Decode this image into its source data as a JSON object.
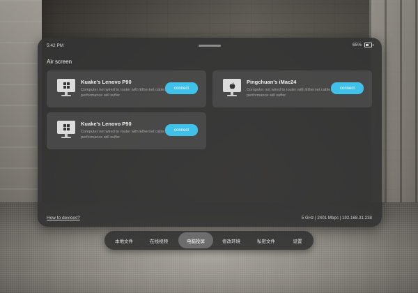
{
  "status_bar": {
    "time": "5:42 PM",
    "battery": "65%"
  },
  "section_title": "Air screen",
  "devices": [
    {
      "name": "Kuake's Lenovo P90",
      "description": "Computer not wired to router with Ethernet cable, performance will suffer",
      "button": "connect",
      "icon": "windows-logo-icon"
    },
    {
      "name": "Pingchuan's iMac24",
      "description": "Computer not wired to router with Ethernet cable, performance will suffer",
      "button": "connect",
      "icon": "apple-logo-icon"
    },
    {
      "name": "Kuake's Lenovo P90",
      "description": "Computer not wired to router with Ethernet cable, performance will suffer",
      "button": "connect",
      "icon": "windows-logo-icon"
    }
  ],
  "footer": {
    "help_link": "How to devices?",
    "network_info": "5 GHz | 2401 Mbps | 192.168.31.238"
  },
  "nav_tabs": [
    {
      "label": "本地文件",
      "active": false
    },
    {
      "label": "在线视频",
      "active": false
    },
    {
      "label": "电脑投屏",
      "active": true
    },
    {
      "label": "修改环境",
      "active": false
    },
    {
      "label": "私密文件",
      "active": false
    },
    {
      "label": "设置",
      "active": false
    }
  ],
  "colors": {
    "accent": "#3fc1e9",
    "panel": "#343434",
    "card": "#4a4a4a"
  }
}
